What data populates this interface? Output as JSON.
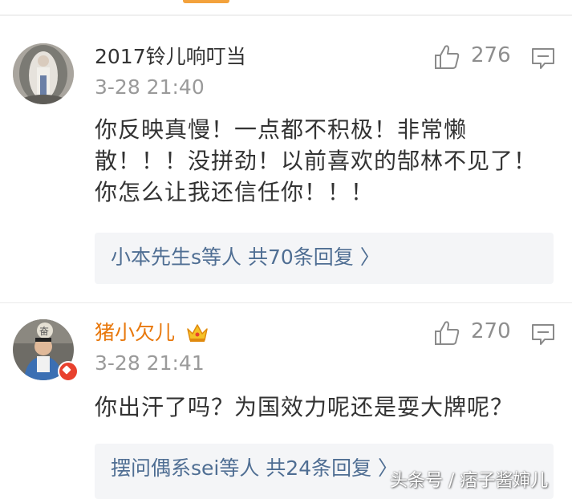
{
  "comments": [
    {
      "username": "2017铃儿响叮当",
      "timestamp": "3-28 21:40",
      "likes": "276",
      "content_lines": [
        "你反映真慢！一点都不积极！非常懒",
        "散！！！没拼劲！以前喜欢的郜林不见了！",
        "你怎么让我还信任你！！！"
      ],
      "replies_summary": "小本先生s等人  共70条回复 〉"
    },
    {
      "username": "猪小欠儿",
      "timestamp": "3-28 21:41",
      "likes": "270",
      "content_lines": [
        "你出汗了吗？为国效力呢还是耍大牌呢？"
      ],
      "replies_summary": "摆问偶系sei等人  共24条回复 〉"
    }
  ],
  "colors": {
    "username_default": "#333333",
    "username_member": "#e8780c",
    "reply_link": "#4f6e93",
    "meta_gray": "#9a9a9a",
    "reply_box_bg": "#f4f5f7"
  },
  "icons": {
    "like": "thumbs-up-icon",
    "reply": "comment-bubble-icon",
    "member": "crown-badge-icon",
    "verified": "verified-badge-icon"
  },
  "watermark": "头条号 / 痞子酱婶儿"
}
